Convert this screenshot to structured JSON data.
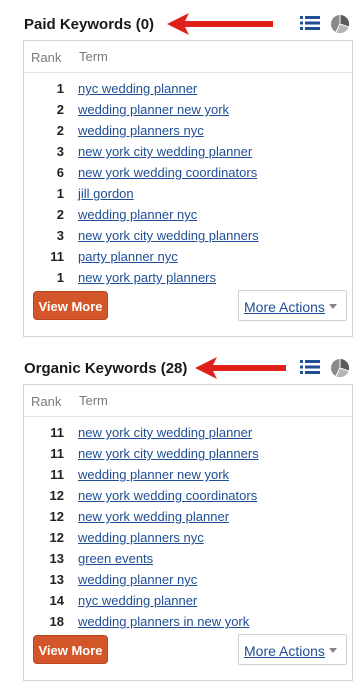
{
  "paid": {
    "title": "Paid Keywords (0)",
    "col_rank": "Rank",
    "col_term": "Term",
    "rows": [
      {
        "rank": "1",
        "term": "nyc wedding planner"
      },
      {
        "rank": "2",
        "term": "wedding planner new york"
      },
      {
        "rank": "2",
        "term": "wedding planners nyc"
      },
      {
        "rank": "3",
        "term": "new york city wedding planner"
      },
      {
        "rank": "6",
        "term": "new york wedding coordinators"
      },
      {
        "rank": "1",
        "term": "jill gordon"
      },
      {
        "rank": "2",
        "term": "wedding planner nyc"
      },
      {
        "rank": "3",
        "term": "new york city wedding planners"
      },
      {
        "rank": "11",
        "term": "party planner nyc"
      },
      {
        "rank": "1",
        "term": "new york party planners"
      }
    ],
    "view_more": "View More",
    "more_actions": "More Actions"
  },
  "organic": {
    "title": "Organic Keywords (28)",
    "col_rank": "Rank",
    "col_term": "Term",
    "rows": [
      {
        "rank": "11",
        "term": "new york city wedding planner"
      },
      {
        "rank": "11",
        "term": "new york city wedding planners"
      },
      {
        "rank": "11",
        "term": "wedding planner new york"
      },
      {
        "rank": "12",
        "term": "new york wedding coordinators"
      },
      {
        "rank": "12",
        "term": "new york wedding planner"
      },
      {
        "rank": "12",
        "term": "wedding planners nyc"
      },
      {
        "rank": "13",
        "term": "green events"
      },
      {
        "rank": "13",
        "term": "wedding planner nyc"
      },
      {
        "rank": "14",
        "term": "nyc wedding planner"
      },
      {
        "rank": "18",
        "term": "wedding planners in new york"
      }
    ],
    "view_more": "View More",
    "more_actions": "More Actions"
  },
  "icons": {
    "arrow": "red-arrow-icon",
    "list": "list-icon",
    "pie": "pie-chart-icon"
  },
  "colors": {
    "link": "#1f4e94",
    "button": "#d3562a",
    "arrow": "#e0201b"
  }
}
